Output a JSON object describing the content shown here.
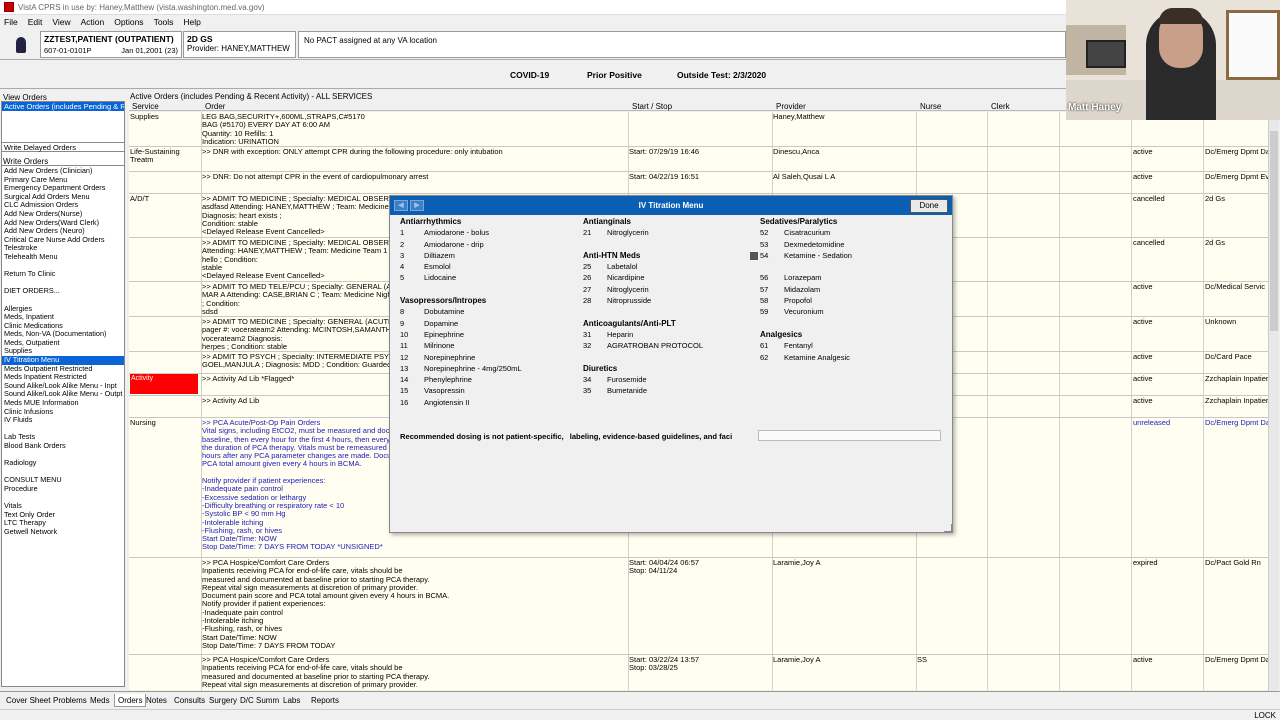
{
  "window": {
    "title": "VistA CPRS in use by: Haney,Matthew  (vista.washington.med.va.gov)"
  },
  "menu": [
    "File",
    "Edit",
    "View",
    "Action",
    "Options",
    "Tools",
    "Help"
  ],
  "patient": {
    "name": "ZZTEST,PATIENT (OUTPATIENT)",
    "ssn": "607-01-0101P",
    "dob": "Jan 01,2001 (23)",
    "location": "2D GS",
    "provider": "Provider:  HANEY,MATTHEW",
    "pact": "No PACT assigned at any VA location"
  },
  "covid": {
    "label": "COVID-19",
    "status": "Prior Positive",
    "test": "Outside Test: 2/3/2020"
  },
  "left": {
    "view_orders_label": "View Orders",
    "view_orders_selected": "Active Orders (includes Pending & Rec",
    "write_delayed": "Write Delayed Orders",
    "write_orders_label": "Write Orders",
    "items": [
      "Add New Orders (Clinician)",
      "Primary Care Menu",
      "Emergency Department Orders",
      "Surgical Add Orders Menu",
      "CLC Admission Orders",
      "Add New Orders(Nurse)",
      "Add New Orders(Ward Clerk)",
      "Add New Orders (Neuro)",
      "Critical Care Nurse Add Orders",
      "Telestroke",
      "Telehealth Menu",
      "",
      "Return To Clinic",
      "",
      "DIET ORDERS...",
      "",
      "Allergies",
      "Meds, Inpatient",
      "Clinic Medications",
      "Meds, Non-VA (Documentation)",
      "Meds, Outpatient",
      "Supplies",
      "IV Titration Menu",
      "Meds Outpatient Restricted",
      "Meds Inpatient Restricted",
      "Sound Alike/Look Alike Menu - Inpt",
      "Sound Alike/Look Alike Menu - Outpt",
      "Meds MUE Information",
      "Clinic Infusions",
      "IV Fluids",
      "",
      "Lab Tests",
      "Blood Bank Orders",
      "",
      "Radiology",
      "",
      "CONSULT MENU",
      "Procedure",
      "",
      "Vitals",
      "Text Only Order",
      "LTC Therapy",
      "Getwell Network"
    ],
    "selected_item": "IV Titration Menu"
  },
  "orders": {
    "header": "Active Orders (includes Pending & Recent Activity) - ALL SERVICES",
    "columns": {
      "service": "Service",
      "order": "Order",
      "start_stop": "Start / Stop",
      "provider": "Provider",
      "nurse": "Nurse",
      "clerk": "Clerk"
    },
    "rows": [
      {
        "service": "Supplies",
        "order": "LEG BAG,SECURITY+,600ML,STRAPS,C#5170\n BAG (#5170) EVERY DAY AT 6:00 AM\nQuantity: 10 Refills: 1\nIndication: URINATION",
        "start": "",
        "provider": "Haney,Matthew",
        "nurse": "",
        "status": "",
        "loc": "",
        "blue": false
      },
      {
        "service": "Life-Sustaining Treatm",
        "order": ">> DNR with exception: ONLY attempt CPR during the following procedure: only intubation",
        "start": "Start: 07/29/19 16:46",
        "provider": "Dinescu,Anca",
        "nurse": "",
        "status": "active",
        "loc": "Dc/Emerg Dpmt Da",
        "blue": false
      },
      {
        "service": "",
        "order": ">> DNR: Do not attempt CPR in the event of cardiopulmonary arrest",
        "start": "Start: 04/22/19 16:51",
        "provider": "Al Saleh,Qusai L A",
        "nurse": "",
        "status": "active",
        "loc": "Dc/Emerg Dpmt Ev",
        "blue": false
      },
      {
        "service": "A/D/T",
        "order": ">> ADMIT TO MEDICINE ; Specialty:  MEDICAL OBSERVA\nasdfasd Attending:  HANEY,MATTHEW ; Team:  Medicine\nDiagnosis: heart exists ;\nCondition: stable\n<Delayed Release Event Cancelled>",
        "start": "",
        "provider": "",
        "nurse": "",
        "status": "cancelled",
        "loc": "2d Gs",
        "blue": false
      },
      {
        "service": "",
        "order": ">> ADMIT TO MEDICINE ; Specialty:  MEDICAL OBSERVA\nAttending:  HANEY,MATTHEW ; Team:  Medicine Team 1\nhello ; Condition:\nstable\n<Delayed Release Event Cancelled>",
        "start": "",
        "provider": "",
        "nurse": "",
        "status": "cancelled",
        "loc": "2d Gs",
        "blue": false
      },
      {
        "service": "",
        "order": ">> ADMIT TO MED TELE/PCU ; Specialty:  GENERAL (AC\nMAR A Attending:  CASE,BRIAN C ; Team:  Medicine Night\n; Condition:\nsdsd",
        "start": "",
        "provider": "",
        "nurse": "",
        "status": "active",
        "loc": "Dc/Medical Servic",
        "blue": false
      },
      {
        "service": "",
        "order": ">> ADMIT TO MEDICINE ; Specialty:  GENERAL (ACUTE)\npager #:  vocerateam2 Attending:  MCINTOSH,SAMANTHA\nvocerateam2 Diagnosis:\nherpes ; Condition: stable",
        "start": "",
        "provider": "",
        "nurse": "",
        "status": "active",
        "loc": "Unknown",
        "blue": false
      },
      {
        "service": "",
        "order": ">> ADMIT TO PSYCH ; Specialty:  INTERMEDIATE PSYC\nGOEL,MANJULA ; Diagnosis: MDD ; Condition: Guarded",
        "start": "",
        "provider": "",
        "nurse": "",
        "status": "active",
        "loc": "Dc/Card Pace",
        "blue": false
      },
      {
        "service": "Activity",
        "order": ">> Activity Ad Lib  *Flagged*",
        "start": "",
        "provider": "",
        "nurse": "",
        "status": "active",
        "loc": "Zzchaplain Inpatier",
        "blue": false
      },
      {
        "service": "",
        "order": ">> Activity Ad Lib",
        "start": "",
        "provider": "",
        "nurse": "",
        "status": "active",
        "loc": "Zzchaplain Inpatier",
        "blue": false
      },
      {
        "service": "Nursing",
        "order": ">> PCA Acute/Post-Op Pain Orders\nVital signs, including EtCO2, must be measured and docum\nbaseline, then every hour for the first 4 hours, then every 4\nthe duration of PCA therapy.  Vitals must be remeasured ev\nhours after any PCA parameter changes are made. Docume\nPCA total amount given every 4 hours in BCMA.\n\nNotify provider if patient experiences:\n -Inadequate pain control\n -Excessive sedation or lethargy\n -Difficulty breathing or respiratory rate < 10\n -Systolic BP < 90 mm Hg\n -Intolerable itching\n -Flushing, rash, or hives\nStart Date/Time: NOW\nStop Date/Time: 7 DAYS FROM TODAY *UNSIGNED*",
        "start": "",
        "provider": "",
        "nurse": "",
        "status": "unreleased",
        "loc": "Dc/Emerg Dpmt Da",
        "blue": true
      },
      {
        "service": "",
        "order": ">> PCA Hospice/Comfort Care Orders\nInpatients receiving PCA for end-of-life care, vitals should be\nmeasured and documented at baseline prior to starting PCA therapy.\nRepeat vital sign measurements at discretion of primary provider.\nDocument pain score and PCA total amount given every 4 hours in BCMA.\n Notify provider if patient experiences:\n -Inadequate pain control\n -Intolerable itching\n -Flushing, rash, or hives\nStart Date/Time: NOW\nStop Date/Time: 7 DAYS FROM TODAY",
        "start": "Start: 04/04/24 06:57\nStop: 04/11/24",
        "provider": "Laramie,Joy A",
        "nurse": "",
        "status": "expired",
        "loc": "Dc/Pact Gold Rn",
        "blue": false
      },
      {
        "service": "",
        "order": ">> PCA Hospice/Comfort Care Orders\nInpatients receiving PCA for end-of-life care, vitals should be\nmeasured and documented at baseline prior to starting PCA therapy.\nRepeat vital sign measurements at discretion of primary provider.",
        "start": "Start: 03/22/24 13:57\nStop: 03/28/25",
        "provider": "Laramie,Joy A",
        "nurse": "SS",
        "status": "active",
        "loc": "Dc/Emerg Dpmt Da",
        "blue": false
      }
    ],
    "red_cell_text": "Activity"
  },
  "tabs": [
    "Cover Sheet",
    "Problems",
    "Meds",
    "Orders",
    "Notes",
    "Consults",
    "Surgery",
    "D/C Summ",
    "Labs",
    "Reports"
  ],
  "selected_tab": "Orders",
  "status_lock": "LOCK",
  "modal": {
    "title": "IV Titration Menu",
    "done": "Done",
    "col1": [
      {
        "h": "Antiarrhythmics"
      },
      {
        "n": "1",
        "t": "Amiodarone - bolus"
      },
      {
        "n": "2",
        "t": "Amiodarone - drip"
      },
      {
        "n": "3",
        "t": "Diltiazem"
      },
      {
        "n": "4",
        "t": "Esmolol"
      },
      {
        "n": "5",
        "t": "Lidocaine"
      },
      {
        "gap": true
      },
      {
        "h": "Vasopressors/Intropes"
      },
      {
        "n": "8",
        "t": "Dobutamine"
      },
      {
        "n": "9",
        "t": "Dopamine"
      },
      {
        "n": "10",
        "t": "Epinephrine"
      },
      {
        "n": "11",
        "t": "Milrinone"
      },
      {
        "n": "12",
        "t": "Norepinephrine"
      },
      {
        "n": "13",
        "t": "Norepinephrine - 4mg/250mL"
      },
      {
        "n": "14",
        "t": "Phenylephrine"
      },
      {
        "n": "15",
        "t": "Vasopressin"
      },
      {
        "n": "16",
        "t": "Angiotensin II"
      }
    ],
    "col2": [
      {
        "h": "Antianginals"
      },
      {
        "n": "21",
        "t": "Nitroglycerin"
      },
      {
        "gap": true
      },
      {
        "h": "Anti-HTN Meds"
      },
      {
        "n": "25",
        "t": "Labetalol"
      },
      {
        "n": "26",
        "t": "Nicardipine"
      },
      {
        "n": "27",
        "t": "Nitroglycerin"
      },
      {
        "n": "28",
        "t": "Nitroprusside"
      },
      {
        "gap": true
      },
      {
        "h": "Anticoagulants/Anti-PLT"
      },
      {
        "n": "31",
        "t": "Heparin"
      },
      {
        "n": "32",
        "t": "AGRATROBAN PROTOCOL"
      },
      {
        "gap": true
      },
      {
        "h": "Diuretics"
      },
      {
        "n": "34",
        "t": "Furosemide"
      },
      {
        "n": "35",
        "t": "Bumetanide"
      }
    ],
    "col3": [
      {
        "h": "Sedatives/Paralytics"
      },
      {
        "n": "52",
        "t": "Cisatracurium"
      },
      {
        "n": "53",
        "t": "Dexmedetomidine"
      },
      {
        "n": "54",
        "t": "Ketamine - Sedation",
        "chk": true
      },
      {
        "gap": true
      },
      {
        "n": "56",
        "t": "Lorazepam"
      },
      {
        "n": "57",
        "t": "Midazolam"
      },
      {
        "n": "58",
        "t": "Propofol"
      },
      {
        "n": "59",
        "t": "Vecuronium"
      },
      {
        "gap": true
      },
      {
        "h": "Analgesics"
      },
      {
        "n": "61",
        "t": "Fentanyl"
      },
      {
        "n": "62",
        "t": "Ketamine Analgesic"
      }
    ],
    "footnote_a": "Recommended dosing is not patient-specific,",
    "footnote_b": "labeling, evidence-based guidelines, and faci"
  },
  "webcam": {
    "name": "Matt Haney"
  }
}
